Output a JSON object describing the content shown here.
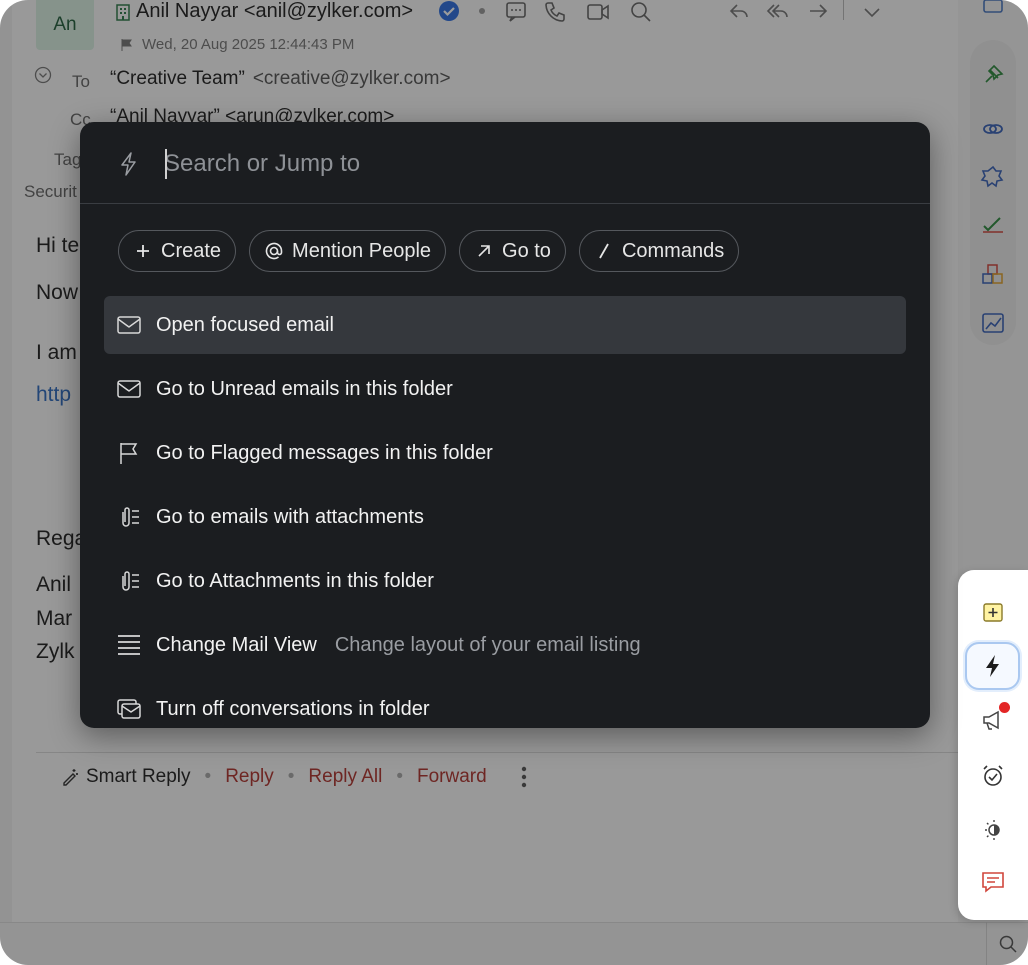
{
  "mail": {
    "avatar_initials": "An",
    "sender": "Anil Nayyar <anil@zylker.com>",
    "date": "Wed, 20 Aug 2025 12:44:43 PM",
    "to_label": "To",
    "to_name": "“Creative Team”",
    "to_address": "<creative@zylker.com>",
    "cc_label": "Cc",
    "cc_value": "“Anil Nayyar”  <arun@zylker.com>",
    "tags_label": "Tag",
    "security_label": "Securit",
    "body": {
      "greeting": "Hi te",
      "line2": "Now",
      "line3": "I am",
      "link": "http",
      "regards": "Rega",
      "sig1": "Anil",
      "sig2": "Mar",
      "sig3": "Zylk"
    },
    "actions": {
      "smart_reply": "Smart Reply",
      "reply": "Reply",
      "reply_all": "Reply All",
      "forward": "Forward",
      "separator": "•"
    }
  },
  "palette": {
    "search_placeholder": "Search or Jump to",
    "chips": [
      {
        "label": "Create",
        "icon": "plus-icon"
      },
      {
        "label": "Mention People",
        "icon": "at-icon"
      },
      {
        "label": "Go to",
        "icon": "arrow-up-right-icon"
      },
      {
        "label": "Commands",
        "icon": "slash-icon"
      }
    ],
    "items": [
      {
        "label": "Open focused email",
        "desc": "",
        "icon": "envelope-icon",
        "selected": true
      },
      {
        "label": "Go to Unread emails in this folder",
        "desc": "",
        "icon": "envelope-icon",
        "selected": false
      },
      {
        "label": "Go to Flagged messages in this folder",
        "desc": "",
        "icon": "flag-icon",
        "selected": false
      },
      {
        "label": "Go to emails with attachments",
        "desc": "",
        "icon": "attachment-list-icon",
        "selected": false
      },
      {
        "label": "Go to Attachments in this folder",
        "desc": "",
        "icon": "attachment-list-icon",
        "selected": false
      },
      {
        "label": "Change Mail View",
        "desc": "Change layout of your email listing",
        "icon": "list-view-icon",
        "selected": false
      },
      {
        "label": "Turn off conversations in folder",
        "desc": "",
        "icon": "conversation-icon",
        "selected": false
      }
    ]
  },
  "tools": [
    {
      "name": "sticky-note-icon",
      "active": false
    },
    {
      "name": "bolt-icon",
      "active": true
    },
    {
      "name": "announcement-icon",
      "active": false,
      "badge": true
    },
    {
      "name": "alarm-clock-icon",
      "active": false
    },
    {
      "name": "theme-toggle-icon",
      "active": false
    },
    {
      "name": "chat-icon",
      "active": false
    }
  ],
  "colors": {
    "palette_bg": "#1b1d20",
    "selected_row": "#35383d",
    "link_red": "#b0342f",
    "badge_red": "#e32626",
    "active_tool_border": "#aac8f0"
  }
}
